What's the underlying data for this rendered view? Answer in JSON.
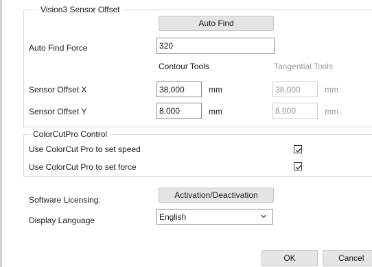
{
  "vision3": {
    "group_title": "Vision3 Sensor Offset",
    "auto_find_button": "Auto Find",
    "auto_find_force_label": "Auto Find Force",
    "auto_find_force_value": "320",
    "contour_tools_header": "Contour Tools",
    "tangential_tools_header": "Tangential Tools",
    "sensor_offset_x_label": "Sensor Offset X",
    "sensor_offset_y_label": "Sensor Offset Y",
    "contour_x_value": "38,000",
    "contour_y_value": "8,000",
    "tangential_x_value": "38,000",
    "tangential_y_value": "8,000",
    "unit": "mm"
  },
  "colorcut": {
    "group_title": "ColorCutPro Control",
    "speed_label": "Use ColorCut Pro to set speed",
    "force_label": "Use ColorCut Pro to set force",
    "speed_checked": true,
    "force_checked": true
  },
  "licensing": {
    "label": "Software Licensing:",
    "button": "Activation/Deactivation"
  },
  "language": {
    "label": "Display Language",
    "selected": "English"
  },
  "footer": {
    "ok": "OK",
    "cancel": "Cancel"
  }
}
